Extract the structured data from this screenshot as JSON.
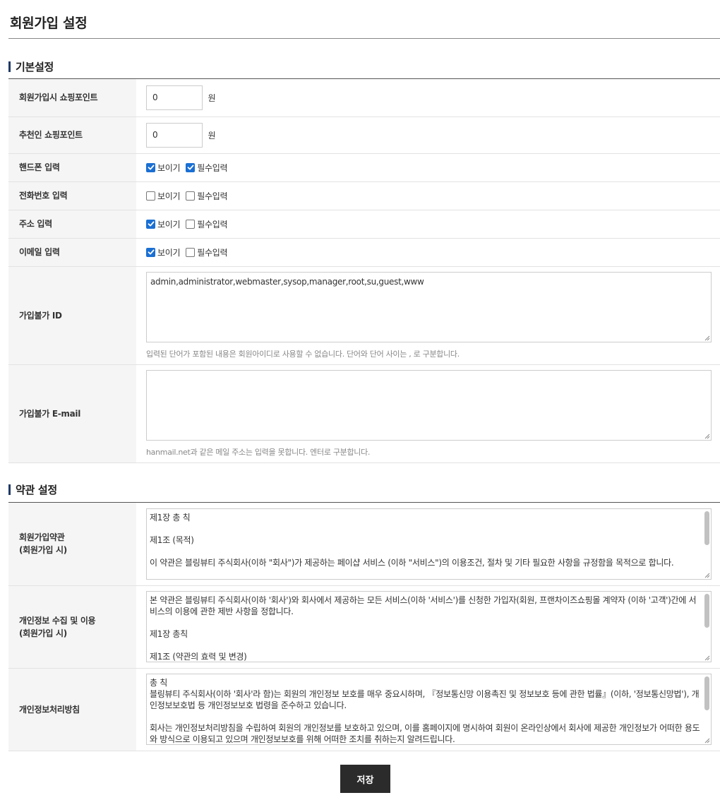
{
  "page": {
    "title": "회원가입 설정"
  },
  "basic": {
    "heading": "기본설정",
    "signup_point": {
      "label": "회원가입시 쇼핑포인트",
      "value": "0",
      "unit": "원"
    },
    "referral_point": {
      "label": "추천인 쇼핑포인트",
      "value": "0",
      "unit": "원"
    },
    "phone": {
      "label": "핸드폰 입력",
      "show_label": "보이기",
      "show": true,
      "required_label": "필수입력",
      "required": true
    },
    "tel": {
      "label": "전화번호 입력",
      "show_label": "보이기",
      "show": false,
      "required_label": "필수입력",
      "required": false
    },
    "address": {
      "label": "주소 입력",
      "show_label": "보이기",
      "show": true,
      "required_label": "필수입력",
      "required": false
    },
    "email": {
      "label": "이메일 입력",
      "show_label": "보이기",
      "show": true,
      "required_label": "필수입력",
      "required": false
    },
    "banned_id": {
      "label": "가입불가 ID",
      "value": "admin,administrator,webmaster,sysop,manager,root,su,guest,www",
      "help": "입력된 단어가 포함된 내용은 회원아이디로 사용할 수 없습니다. 단어와 단어 사이는 , 로 구분합니다."
    },
    "banned_email": {
      "label": "가입불가 E-mail",
      "value": "",
      "help": "hanmail.net과 같은 메일 주소는 입력을 못합니다. 엔터로 구분합니다."
    }
  },
  "terms": {
    "heading": "약관 설정",
    "signup_terms": {
      "label_line1": "회원가입약관",
      "label_line2": "(회원가입 시)",
      "text": "제1장 총 칙\n\n제1조 (목적)\n\n이 약관은 블링뷰티 주식회사(이하 \"회사\")가 제공하는 페이샵 서비스 (이하 \"서비스\")의 이용조건, 절차 및 기타 필요한 사항을 규정함을 목적으로 합니다."
    },
    "privacy_collect": {
      "label_line1": "개인정보 수집 및 이용",
      "label_line2": "(회원가입 시)",
      "text": "본 약관은 블링뷰티 주식회사(이하 '회사')와 회사에서 제공하는 모든 서비스(이하 '서비스')를 신청한 가입자(회원, 프랜차이즈쇼핑몰 계약자 (이하 '고객')간에 서비스의 이용에 관한 제반 사항을 정합니다.\n\n제1장 총칙\n\n제1조 (약관의 효력 및 변경)"
    },
    "privacy_policy": {
      "label_line1": "개인정보처리방침",
      "label_line2": "",
      "text": "총 칙\n블링뷰티 주식회사(이하 '회사'라 함)는 회원의 개인정보 보호를 매우 중요시하며, 『정보통신망 이용촉진 및 정보보호 등에 관한 법률』(이하, '정보통신망법'), 개인정보보호법 등 개인정보보호 법령을 준수하고 있습니다.\n\n회사는 개인정보처리방침을 수립하여 회원의 개인정보를 보호하고 있으며, 이를 홈페이지에 명시하여 회원이 온라인상에서 회사에 제공한 개인정보가 어떠한 용도와 방식으로 이용되고 있으며 개인정보보호를 위해 어떠한 조치를 취하는지 알려드립니다."
    }
  },
  "actions": {
    "save_label": "저장"
  },
  "colors": {
    "accent": "#1f3a67",
    "checkbox": "#1a6fd3",
    "button": "#2b2b2b"
  }
}
